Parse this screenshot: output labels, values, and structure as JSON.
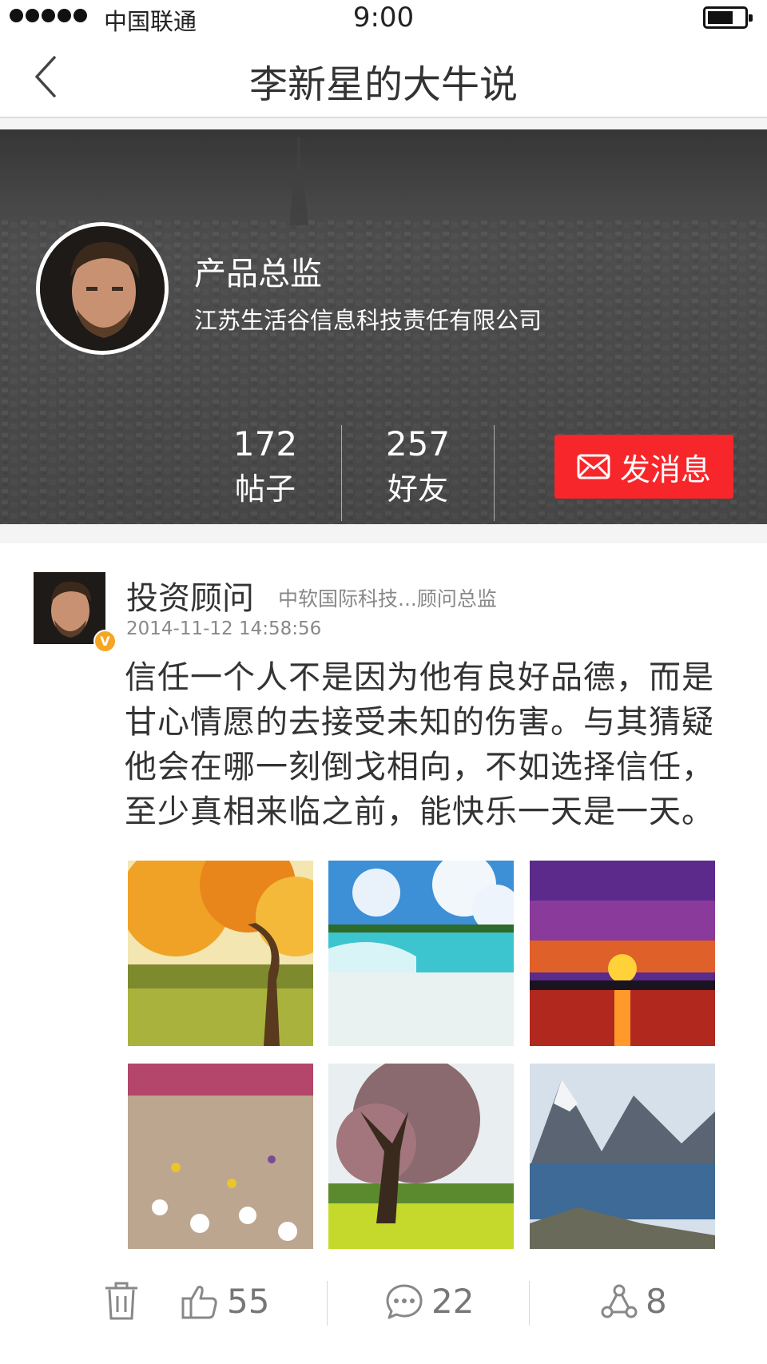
{
  "status_bar": {
    "carrier": "中国联通",
    "time": "9:00"
  },
  "nav": {
    "title": "李新星的大牛说"
  },
  "profile": {
    "role": "产品总监",
    "company": "江苏生活谷信息科技责任有限公司",
    "stats": [
      {
        "value": "172",
        "label": "帖子"
      },
      {
        "value": "257",
        "label": "好友"
      }
    ],
    "message_button": "发消息"
  },
  "post": {
    "author": "投资顾问",
    "author_meta": "中软国际科技...顾问总监",
    "timestamp": "2014-11-12 14:58:56",
    "verified_badge": "V",
    "body_lines": [
      "信任一个人不是因为他有良好品德，而是",
      "甘心情愿的去接受未知的伤害。与其猜疑",
      "他会在哪一刻倒戈相向，不如选择信任，",
      "至少真相来临之前，能快乐一天是一天。"
    ],
    "photos": [
      "autumn tree",
      "beach",
      "sunset",
      "desert flowers",
      "blossom tree",
      "mountain fjord"
    ],
    "actions": {
      "like_count": "55",
      "comment_count": "22",
      "share_count": "8"
    }
  },
  "colors": {
    "accent": "#f7262a",
    "verified": "#f5a623"
  }
}
